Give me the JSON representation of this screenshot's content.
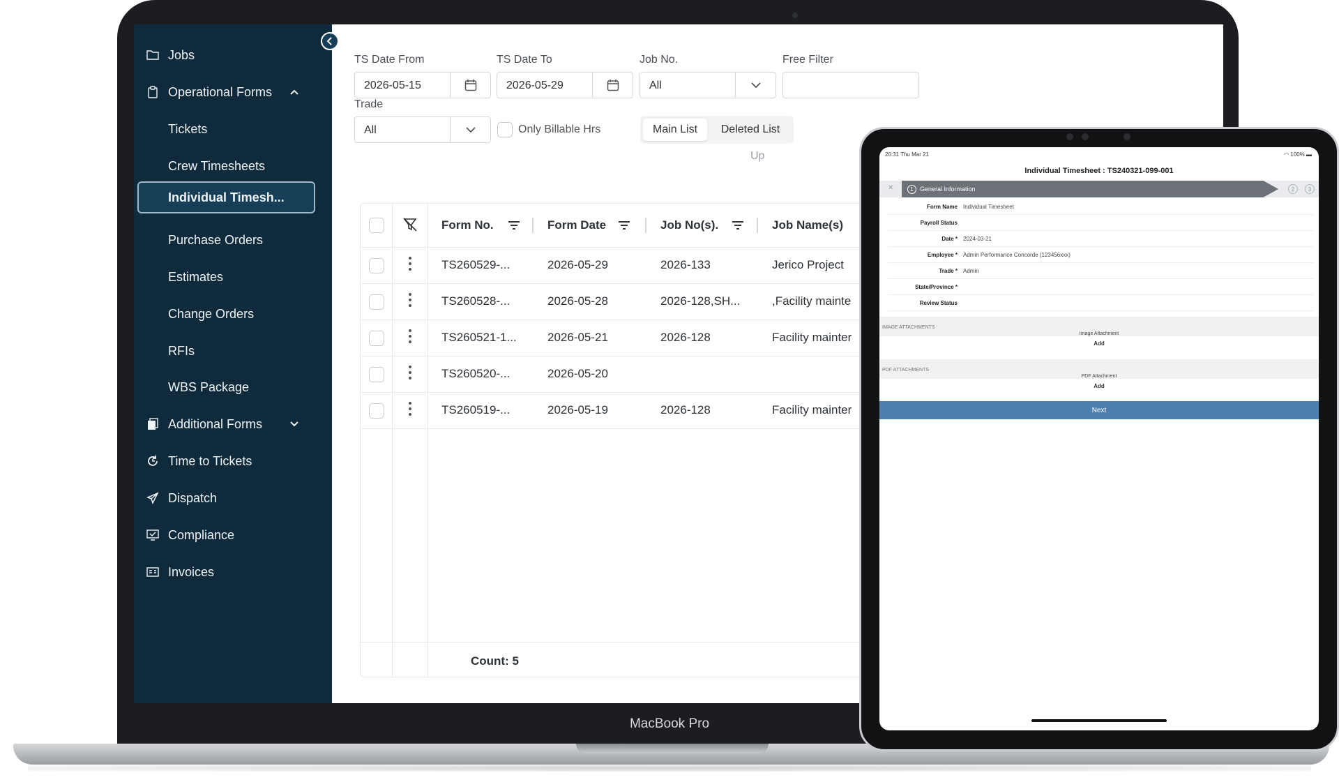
{
  "device": {
    "laptop_label": "MacBook Pro"
  },
  "sidebar": {
    "items": [
      {
        "label": "Jobs",
        "icon": "folder-icon"
      },
      {
        "label": "Operational Forms",
        "icon": "clipboard-icon",
        "expanded": true
      },
      {
        "label": "Tickets"
      },
      {
        "label": "Crew Timesheets"
      },
      {
        "label": "Individual Timesh...",
        "active": true
      },
      {
        "label": "Purchase Orders"
      },
      {
        "label": "Estimates"
      },
      {
        "label": "Change Orders"
      },
      {
        "label": "RFIs"
      },
      {
        "label": "WBS Package"
      },
      {
        "label": "Additional Forms",
        "icon": "documents-icon",
        "expanded": false
      },
      {
        "label": "Time to Tickets",
        "icon": "clock-refresh-icon"
      },
      {
        "label": "Dispatch",
        "icon": "paper-plane-icon"
      },
      {
        "label": "Compliance",
        "icon": "monitor-check-icon"
      },
      {
        "label": "Invoices",
        "icon": "invoice-icon"
      }
    ],
    "active_border_color": "#9fb9c9",
    "background_color": "#0e2a3b"
  },
  "filters": {
    "ts_date_from": {
      "label": "TS Date From",
      "value": "2026-05-15"
    },
    "ts_date_to": {
      "label": "TS Date To",
      "value": "2026-05-29"
    },
    "job_no": {
      "label": "Job No.",
      "value": "All"
    },
    "free_filter": {
      "label": "Free Filter",
      "value": ""
    },
    "trade": {
      "label": "Trade",
      "value": "All"
    },
    "only_billable": {
      "label": "Only Billable Hrs",
      "checked": false
    },
    "list_tabs": [
      "Main List",
      "Deleted List"
    ],
    "active_tab": "Main List",
    "partial_text": "Up"
  },
  "table": {
    "columns": [
      "Form No.",
      "Form Date",
      "Job No(s).",
      "Job Name(s)"
    ],
    "rows": [
      [
        "TS260529-...",
        "2026-05-29",
        "2026-133",
        "Jerico Project"
      ],
      [
        "TS260528-...",
        "2026-05-28",
        "2026-128,SH...",
        ",Facility mainte"
      ],
      [
        "TS260521-1...",
        "2026-05-21",
        "2026-128",
        "Facility mainter"
      ],
      [
        "TS260520-...",
        "2026-05-20",
        "",
        ""
      ],
      [
        "TS260519-...",
        "2026-05-19",
        "2026-128",
        "Facility mainter"
      ]
    ],
    "count_label": "Count: 5"
  },
  "tablet": {
    "status_time": "20:31  Thu Mar 21",
    "status_right": "100%",
    "title": "Individual Timesheet : TS240321-099-001",
    "steps": [
      {
        "num": "1",
        "label": "General Information"
      },
      {
        "num": "2",
        "label": ""
      },
      {
        "num": "3",
        "label": ""
      }
    ],
    "close_glyph": "✕",
    "fields": [
      {
        "key": "Form Name",
        "value": "Individual Timesheet"
      },
      {
        "key": "Payroll Status",
        "value": ""
      },
      {
        "key": "Date *",
        "value": "2024-03-21"
      },
      {
        "key": "Employee *",
        "value": "Admin Performance Concorde (123456xxx)"
      },
      {
        "key": "Trade *",
        "value": "Admin"
      },
      {
        "key": "State/Province *",
        "value": ""
      },
      {
        "key": "Review Status",
        "value": ""
      }
    ],
    "image_section": {
      "header": "IMAGE ATTACHMENTS",
      "caption": "Image Attachment",
      "add": "Add"
    },
    "pdf_section": {
      "header": "PDF ATTACHMENTS",
      "caption": "PDF Attachment",
      "add": "Add"
    },
    "next_label": "Next",
    "accent_color": "#4c7fad"
  }
}
